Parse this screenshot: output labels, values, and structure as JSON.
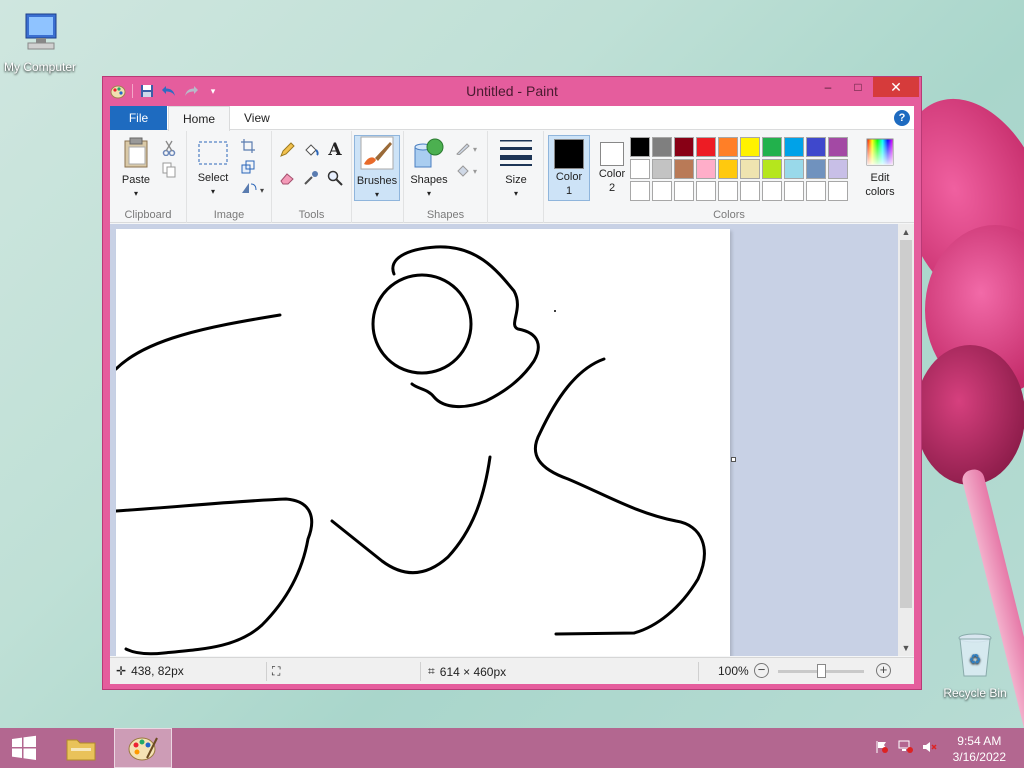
{
  "desktop": {
    "my_computer_label": "My Computer",
    "recycle_bin_label": "Recycle Bin"
  },
  "window": {
    "title": "Untitled - Paint",
    "controls": {
      "minimize": "–",
      "maximize": "□",
      "close": "✕"
    }
  },
  "tabs": {
    "file": "File",
    "home": "Home",
    "view": "View",
    "help": "?"
  },
  "ribbon": {
    "clipboard": {
      "paste": "Paste",
      "group": "Clipboard"
    },
    "image": {
      "select": "Select",
      "group": "Image"
    },
    "tools": {
      "group": "Tools",
      "text_tool": "A"
    },
    "brushes": {
      "label": "Brushes"
    },
    "shapes": {
      "label": "Shapes",
      "group": "Shapes"
    },
    "size": {
      "label": "Size"
    },
    "colors": {
      "color1_label": "Color\n1",
      "color1_line1": "Color",
      "color1_line2": "1",
      "color2_line1": "Color",
      "color2_line2": "2",
      "edit_line1": "Edit",
      "edit_line2": "colors",
      "group": "Colors",
      "color1": "#000000",
      "color2": "#ffffff",
      "palette_row1": [
        "#000000",
        "#7f7f7f",
        "#880015",
        "#ed1c24",
        "#ff7f27",
        "#fff200",
        "#22b14c",
        "#00a2e8",
        "#3f48cc",
        "#a349a4"
      ],
      "palette_row2": [
        "#ffffff",
        "#c3c3c3",
        "#b97a57",
        "#ffaec9",
        "#ffc90e",
        "#efe4b0",
        "#b5e61d",
        "#99d9ea",
        "#7092be",
        "#c8bfe7"
      ],
      "palette_row3": [
        "#ffffff",
        "#ffffff",
        "#ffffff",
        "#ffffff",
        "#ffffff",
        "#ffffff",
        "#ffffff",
        "#ffffff",
        "#ffffff",
        "#ffffff"
      ]
    }
  },
  "status": {
    "cursor_pos": "438, 82px",
    "canvas_size": "614 × 460px",
    "zoom": "100%",
    "zoom_fraction": 0.5
  },
  "taskbar": {
    "time": "9:54 AM",
    "date": "3/16/2022"
  }
}
